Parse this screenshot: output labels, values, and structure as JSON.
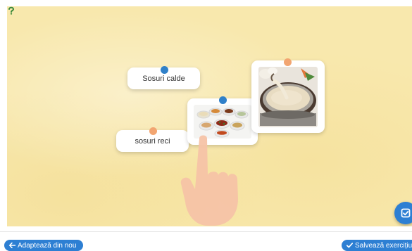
{
  "exercise": {
    "cards": {
      "hot_sauces": "Sosuri calde",
      "cold_sauces": "sosuri reci"
    },
    "images": {
      "bowls": "sauce-bowls-photo",
      "pot": "fondue-pot-photo"
    },
    "dot_colors": {
      "blue": "#2f80c9",
      "orange": "#f2a571"
    },
    "background_color": "#f8e8ad"
  },
  "footer": {
    "reset_label": "Adaptează din nou",
    "save_label": "Salvează exercițiu"
  },
  "icons": [
    "help-icon",
    "check-square-icon",
    "arrow-left-icon",
    "checkmark-icon",
    "hand-pointer-icon"
  ],
  "accent_color": "#2d7fd3"
}
